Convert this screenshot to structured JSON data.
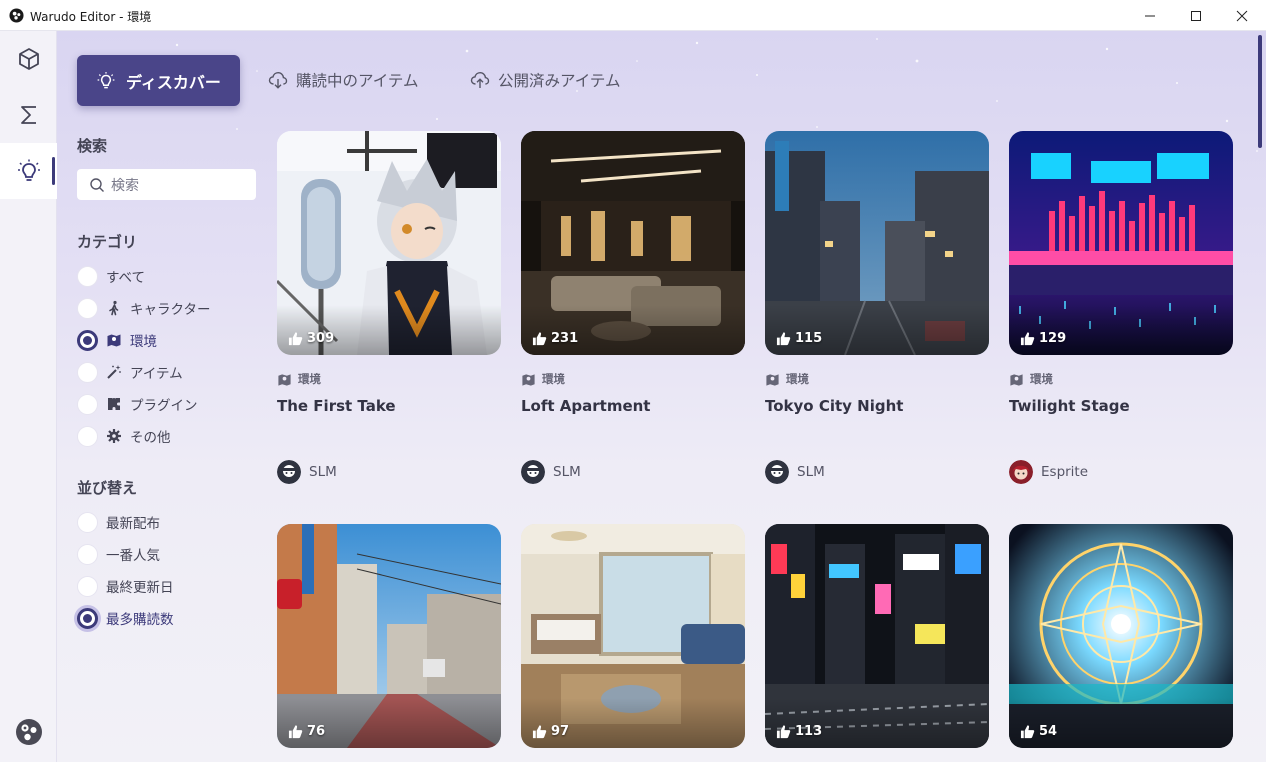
{
  "window": {
    "title": "Warudo Editor - 環境"
  },
  "rail": {
    "items": [
      "cube-icon",
      "sigma-icon",
      "lightbulb-icon"
    ],
    "active": "lightbulb-icon"
  },
  "tabs": {
    "discover": "ディスカバー",
    "subscribed": "購読中のアイテム",
    "published": "公開済みアイテム"
  },
  "search": {
    "title": "検索",
    "placeholder": "検索"
  },
  "category": {
    "title": "カテゴリ",
    "options": [
      "すべて",
      "キャラクター",
      "環境",
      "アイテム",
      "プラグイン",
      "その他"
    ],
    "selected": "環境"
  },
  "sort": {
    "title": "並び替え",
    "options": [
      "最新配布",
      "一番人気",
      "最終更新日",
      "最多購読数"
    ],
    "selected": "最多購読数"
  },
  "cards": [
    {
      "likes": "309",
      "category": "環境",
      "title": "The First Take",
      "author": "SLM"
    },
    {
      "likes": "231",
      "category": "環境",
      "title": "Loft Apartment",
      "author": "SLM"
    },
    {
      "likes": "115",
      "category": "環境",
      "title": "Tokyo City Night",
      "author": "SLM"
    },
    {
      "likes": "129",
      "category": "環境",
      "title": "Twilight Stage",
      "author": "Esprite"
    },
    {
      "likes": "76"
    },
    {
      "likes": "97"
    },
    {
      "likes": "113"
    },
    {
      "likes": "54"
    }
  ],
  "colors": {
    "accent": "#4a4589",
    "accent_dark": "#3c3a7a",
    "background_top": "#d9d5f1",
    "background_bottom": "#f2f1f7"
  }
}
